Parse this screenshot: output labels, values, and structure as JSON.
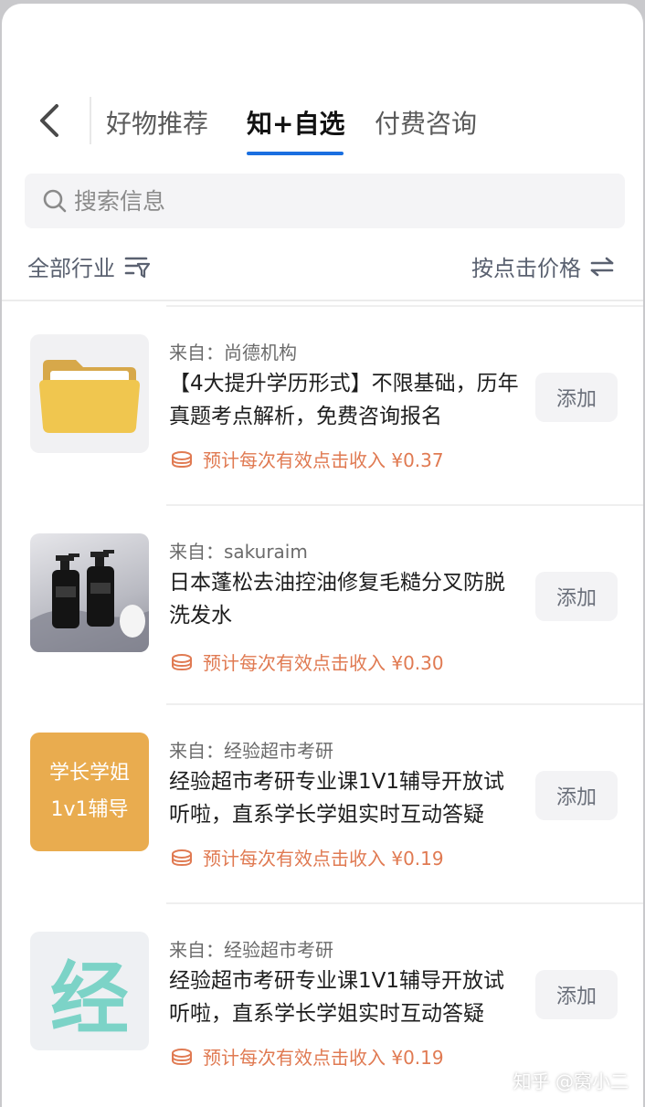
{
  "header": {
    "tabs": [
      {
        "label": "好物推荐",
        "active": false
      },
      {
        "label": "知+自选",
        "active": true
      },
      {
        "label": "付费咨询",
        "active": false
      }
    ],
    "accent_color": "#1a6fe0"
  },
  "search": {
    "placeholder": "搜索信息"
  },
  "filters": {
    "industry": "全部行业",
    "sort": "按点击价格"
  },
  "items": [
    {
      "source": "来自：尚德机构",
      "title": "【4大提升学历形式】不限基础，历年真题考点解析，免费咨询报名",
      "income": "预计每次有效点击收入 ¥0.37",
      "add_label": "添加",
      "thumb": "folder-image"
    },
    {
      "source": "来自：sakuraim",
      "title": "日本蓬松去油控油修复毛糙分叉防脱洗发水",
      "income": "预计每次有效点击收入 ¥0.30",
      "add_label": "添加",
      "thumb": "shampoo-bottles-image"
    },
    {
      "source": "来自：经验超市考研",
      "title": "经验超市考研专业课1V1辅导开放试听啦，直系学长学姐实时互动答疑",
      "income": "预计每次有效点击收入 ¥0.19",
      "add_label": "添加",
      "thumb_text": [
        "学长学姐",
        "1v1辅导"
      ]
    },
    {
      "source": "来自：经验超市考研",
      "title": "经验超市考研专业课1V1辅导开放试听啦，直系学长学姐实时互动答疑",
      "income": "预计每次有效点击收入 ¥0.19",
      "add_label": "添加",
      "thumb_glyph": "经"
    }
  ],
  "watermark": "知乎 @窝小二",
  "income_color": "#e07a52"
}
